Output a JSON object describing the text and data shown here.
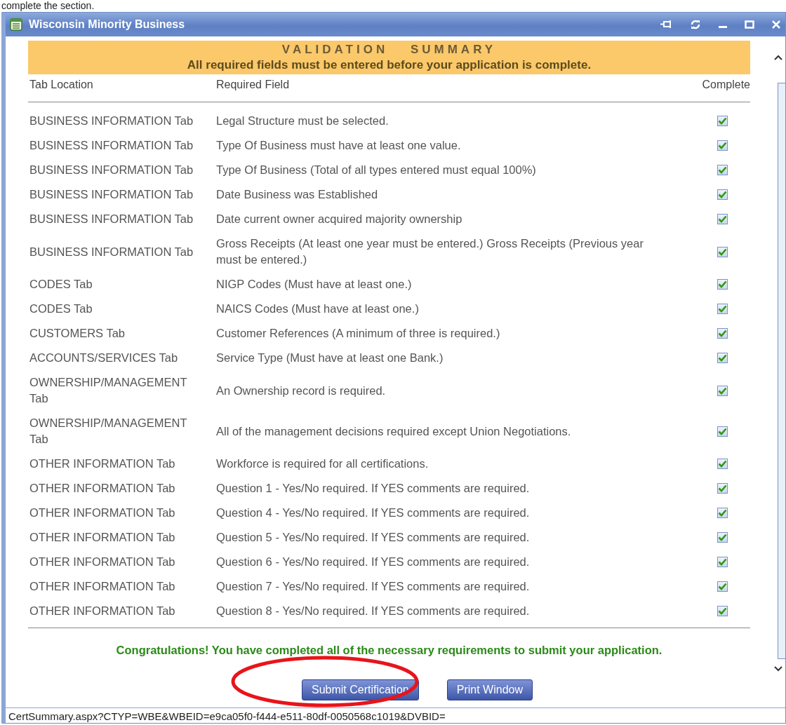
{
  "background": {
    "text": "complete the section."
  },
  "window": {
    "title": "Wisconsin Minority Business"
  },
  "summary": {
    "title": "VALIDATION SUMMARY",
    "subtitle": "All required fields must be entered before your application is complete."
  },
  "table": {
    "columns": [
      "Tab Location",
      "Required Field",
      "Complete"
    ],
    "rows": [
      {
        "tab": "BUSINESS INFORMATION Tab",
        "field": "Legal Structure must be selected.",
        "complete": true
      },
      {
        "tab": "BUSINESS INFORMATION Tab",
        "field": "Type Of Business must have at least one value.",
        "complete": true
      },
      {
        "tab": "BUSINESS INFORMATION Tab",
        "field": "Type Of Business (Total of all types entered must equal 100%)",
        "complete": true
      },
      {
        "tab": "BUSINESS INFORMATION Tab",
        "field": "Date Business was Established",
        "complete": true
      },
      {
        "tab": "BUSINESS INFORMATION Tab",
        "field": "Date current owner acquired majority ownership",
        "complete": true
      },
      {
        "tab": "BUSINESS INFORMATION Tab",
        "field": "Gross Receipts (At least one year must be entered.) Gross Receipts (Previous year must be entered.)",
        "complete": true
      },
      {
        "tab": "CODES Tab",
        "field": "NIGP Codes (Must have at least one.)",
        "complete": true
      },
      {
        "tab": "CODES Tab",
        "field": "NAICS Codes (Must have at least one.)",
        "complete": true
      },
      {
        "tab": "CUSTOMERS Tab",
        "field": "Customer References (A minimum of three is required.)",
        "complete": true
      },
      {
        "tab": "ACCOUNTS/SERVICES Tab",
        "field": "Service Type (Must have at least one Bank.)",
        "complete": true
      },
      {
        "tab": "OWNERSHIP/MANAGEMENT Tab",
        "field": "An Ownership record is required.",
        "complete": true
      },
      {
        "tab": "OWNERSHIP/MANAGEMENT Tab",
        "field": "All of the management decisions required except Union Negotiations.",
        "complete": true
      },
      {
        "tab": "OTHER INFORMATION Tab",
        "field": "Workforce is required for all certifications.",
        "complete": true
      },
      {
        "tab": "OTHER INFORMATION Tab",
        "field": "Question 1 - Yes/No required. If YES comments are required.",
        "complete": true
      },
      {
        "tab": "OTHER INFORMATION Tab",
        "field": "Question 4 - Yes/No required. If YES comments are required.",
        "complete": true
      },
      {
        "tab": "OTHER INFORMATION Tab",
        "field": "Question 5 - Yes/No required. If YES comments are required.",
        "complete": true
      },
      {
        "tab": "OTHER INFORMATION Tab",
        "field": "Question 6 - Yes/No required. If YES comments are required.",
        "complete": true
      },
      {
        "tab": "OTHER INFORMATION Tab",
        "field": "Question 7 - Yes/No required. If YES comments are required.",
        "complete": true
      },
      {
        "tab": "OTHER INFORMATION Tab",
        "field": "Question 8 - Yes/No required. If YES comments are required.",
        "complete": true
      }
    ]
  },
  "message": "Congratulations! You have completed all of the necessary requirements to submit your application.",
  "buttons": [
    "Submit Certification",
    "Print Window"
  ],
  "status_bar": {
    "text": "CertSummary.aspx?CTYP=WBE&WBEID=e9ca05f0-f444-e511-80df-0050568c1019&DVBID="
  }
}
